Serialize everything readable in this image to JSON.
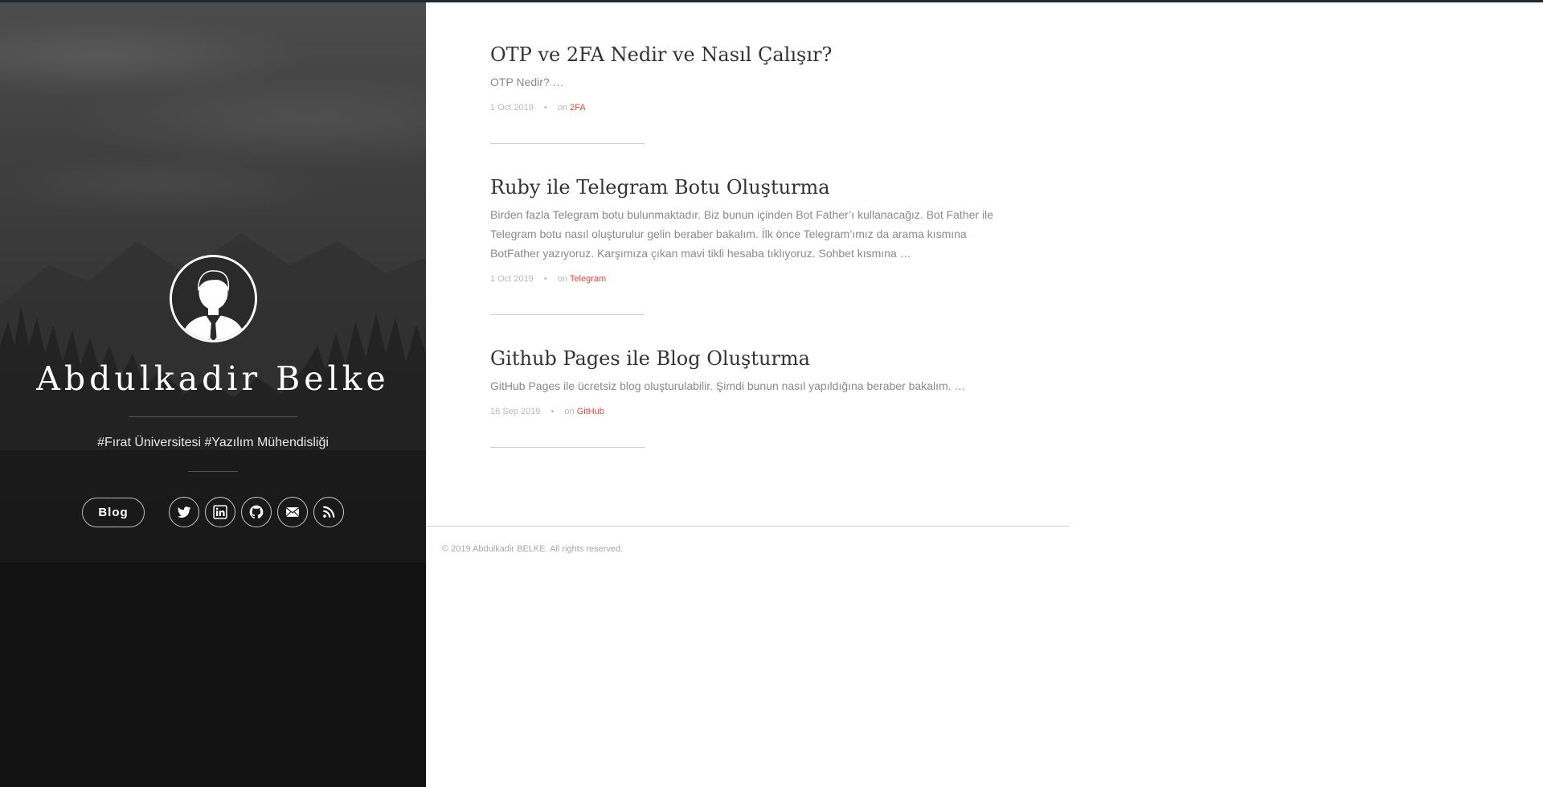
{
  "profile": {
    "name": "Abdulkadir Belke",
    "tagline": "#Fırat Üniversitesi #Yazılım Mühendisliği"
  },
  "nav": {
    "blog_label": "Blog"
  },
  "social_links": [
    {
      "name": "twitter",
      "icon": "twitter-icon"
    },
    {
      "name": "linkedin",
      "icon": "linkedin-icon"
    },
    {
      "name": "github",
      "icon": "github-icon"
    },
    {
      "name": "email",
      "icon": "mail-icon"
    },
    {
      "name": "rss",
      "icon": "rss-icon"
    }
  ],
  "posts": [
    {
      "title": "OTP ve 2FA Nedir ve Nasıl Çalışır?",
      "excerpt": "OTP Nedir? …",
      "date": "1 Oct 2019",
      "dot": "•",
      "on": "on",
      "category": "2FA"
    },
    {
      "title": "Ruby ile Telegram Botu Oluşturma",
      "excerpt": "Birden fazla Telegram botu bulunmaktadır. Biz bunun içinden Bot Father’ı kullanacağız. Bot Father ile Telegram botu nasıl oluşturulur gelin beraber bakalım. İlk önce Telegram’ımız da arama kısmına BotFather yazıyoruz. Karşımıza çıkan mavi tikli hesaba tıklıyoruz. Sohbet kısmına …",
      "date": "1 Oct 2019",
      "dot": "•",
      "on": "on",
      "category": "Telegram"
    },
    {
      "title": "Github Pages ile Blog Oluşturma",
      "excerpt": "GitHub Pages ile ücretsiz blog oluşturulabilir. Şimdi bunun nasıl yapıldığına beraber bakalım. …",
      "date": "16 Sep 2019",
      "dot": "•",
      "on": "on",
      "category": "GitHub"
    }
  ],
  "footer": {
    "copyright": "© 2019 Abdulkadir BELKE. All rights reserved."
  },
  "colors": {
    "accent": "#e0473d",
    "title": "#333333",
    "excerpt": "#8a8a8a",
    "meta": "#b9b9b9"
  }
}
